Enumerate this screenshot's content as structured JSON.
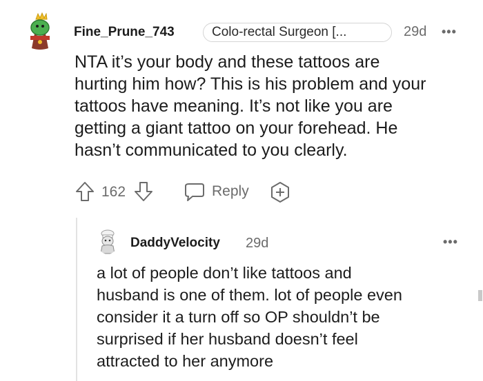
{
  "comment": {
    "username": "Fine_Prune_743",
    "flair": "Colo-rectal Surgeon [...",
    "age": "29d",
    "more_label": "•••",
    "body_lines": [
      "NTA it’s your body and these tattoos are",
      "hurting him how? This is his problem and your",
      "tattoos have meaning. It’s not like you are",
      "getting a giant tattoo on your forehead. He",
      "hasn’t communicated to you clearly."
    ],
    "score": "162",
    "reply_label": "Reply",
    "avatar_icon": "cactus-king-avatar-icon",
    "colors": {
      "text": "#1c1c1c",
      "meta": "#6b6b6b",
      "border": "#d4d4d4"
    }
  },
  "reply": {
    "username": "DaddyVelocity",
    "age": "29d",
    "more_label": "•••",
    "body_lines": [
      "a lot of people don’t like tattoos and",
      "husband is one of them. lot of people even",
      "consider it a turn off so OP shouldn’t be",
      "surprised if her husband doesn’t feel",
      "attracted to her anymore"
    ],
    "avatar_icon": "chef-avatar-icon"
  }
}
